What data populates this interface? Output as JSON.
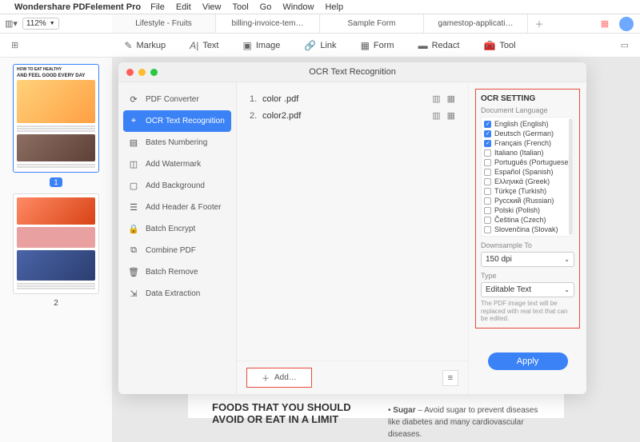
{
  "menubar": {
    "app": "Wondershare PDFelement Pro",
    "items": [
      "File",
      "Edit",
      "View",
      "Tool",
      "Go",
      "Window",
      "Help"
    ]
  },
  "toolbar": {
    "zoom": "112%",
    "tabs": [
      "Lifestyle - Fruits",
      "billing-invoice-tem…",
      "Sample Form",
      "gamestop-applicati…"
    ]
  },
  "tools": {
    "markup": "Markup",
    "text": "Text",
    "image": "Image",
    "link": "Link",
    "form": "Form",
    "redact": "Redact",
    "tool": "Tool"
  },
  "thumbs": {
    "t1_title1": "HOW TO EAT HEALTHY",
    "t1_title2": "AND FEEL GOOD EVERY DAY",
    "page1": "1",
    "page2": "2"
  },
  "doc": {
    "heading": "FOODS THAT YOU SHOULD AVOID OR EAT IN A LIMIT",
    "bullet_label": "Sugar",
    "bullet_text": " – Avoid sugar to prevent diseases like diabetes and many cardiovascular diseases."
  },
  "modal": {
    "title": "OCR Text Recognition",
    "side": {
      "pdf_converter": "PDF Converter",
      "ocr": "OCR Text Recognition",
      "bates": "Bates Numbering",
      "watermark": "Add Watermark",
      "background": "Add Background",
      "headerfooter": "Add Header & Footer",
      "encrypt": "Batch Encrypt",
      "combine": "Combine PDF",
      "remove": "Batch Remove",
      "extract": "Data Extraction"
    },
    "files": [
      {
        "n": "1.",
        "name": "color .pdf"
      },
      {
        "n": "2.",
        "name": "color2.pdf"
      }
    ],
    "add": "Add…",
    "ocr": {
      "heading": "OCR SETTING",
      "doclang": "Document Language",
      "langs": [
        {
          "label": "English (English)",
          "checked": true
        },
        {
          "label": "Deutsch (German)",
          "checked": true
        },
        {
          "label": "Français (French)",
          "checked": true
        },
        {
          "label": "Italiano (Italian)",
          "checked": false
        },
        {
          "label": "Português (Portuguese)",
          "checked": false
        },
        {
          "label": "Español (Spanish)",
          "checked": false
        },
        {
          "label": "Ελληνικά (Greek)",
          "checked": false
        },
        {
          "label": "Türkçe (Turkish)",
          "checked": false
        },
        {
          "label": "Русский (Russian)",
          "checked": false
        },
        {
          "label": "Polski (Polish)",
          "checked": false
        },
        {
          "label": "Čeština (Czech)",
          "checked": false
        },
        {
          "label": "Slovenčina (Slovak)",
          "checked": false
        }
      ],
      "downsample_label": "Downsample To",
      "downsample": "150 dpi",
      "type_label": "Type",
      "type": "Editable Text",
      "help": "The PDF image text will be replaced with real text that can be edited.",
      "apply": "Apply"
    }
  }
}
